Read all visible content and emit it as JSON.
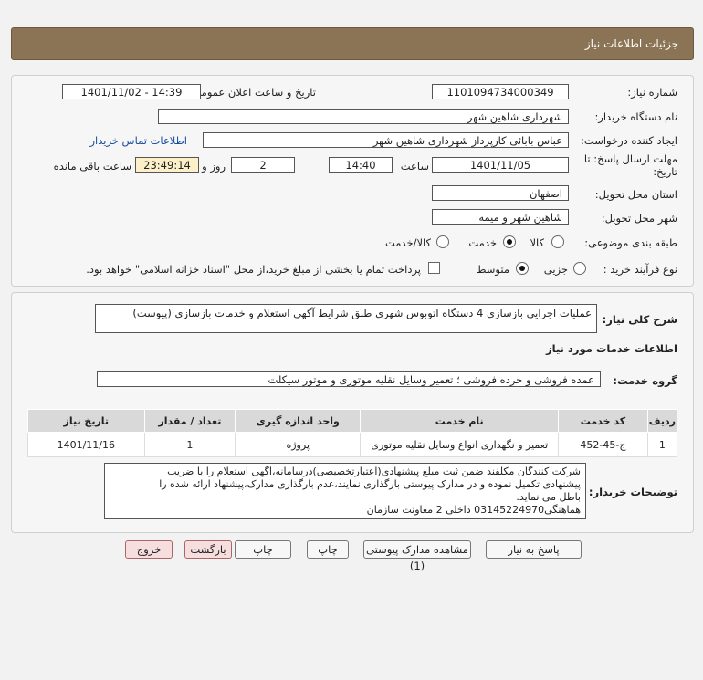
{
  "header": {
    "title": "جزئیات اطلاعات نیاز"
  },
  "form": {
    "need_number": {
      "label": "شماره نیاز:",
      "value": "1101094734000349"
    },
    "announce": {
      "label": "تاریخ و ساعت اعلان عمومی:",
      "value": "1401/11/02 - 14:39"
    },
    "buyer_org": {
      "label": "نام دستگاه خریدار:",
      "value": "شهرداری شاهین شهر"
    },
    "creator": {
      "label": "ایجاد کننده درخواست:",
      "value": "عباس بابائی کارپرداز شهرداری شاهین شهر",
      "contact_link": "اطلاعات تماس خریدار"
    },
    "deadline": {
      "label_line1": "مهلت ارسال پاسخ: تا",
      "label_line2": "تاریخ:",
      "date": "1401/11/05",
      "time_label": "ساعت",
      "time": "14:40",
      "days": "2",
      "days_label": "روز و",
      "remaining": "23:49:14",
      "remaining_label": "ساعت باقی مانده"
    },
    "province": {
      "label": "استان محل تحویل:",
      "value": "اصفهان"
    },
    "city": {
      "label": "شهر محل تحویل:",
      "value": "شاهین شهر و میمه"
    },
    "category": {
      "label": "طبقه بندی موضوعی:",
      "options": [
        "کالا",
        "خدمت",
        "کالا/خدمت"
      ],
      "selected": "خدمت"
    },
    "process": {
      "label": "نوع فرآیند خرید :",
      "options": [
        "جزیی",
        "متوسط"
      ],
      "selected": "متوسط",
      "checkbox_text": "پرداخت تمام یا بخشی از مبلغ خرید،از محل \"اسناد خزانه اسلامی\" خواهد بود."
    }
  },
  "summary": {
    "label": "شرح کلی نیاز:",
    "value": "عملیات اجرایی بازسازی 4 دستگاه اتوبوس شهری طبق شرایط آگهی استعلام و خدمات بازسازی (پیوست)"
  },
  "services": {
    "section_title": "اطلاعات خدمات مورد نیاز",
    "group_label": "گروه خدمت:",
    "group_value": "عمده فروشی و خرده فروشی ؛ تعمیر وسایل نقلیه موتوری و موتور سیکلت",
    "columns": [
      "ردیف",
      "کد خدمت",
      "نام خدمت",
      "واحد اندازه گیری",
      "تعداد / مقدار",
      "تاریخ نیاز"
    ],
    "rows": [
      [
        "1",
        "ج-45-452",
        "تعمیر و نگهداری انواع وسایل نقلیه موتوری",
        "پروژه",
        "1",
        "1401/11/16"
      ]
    ]
  },
  "buyer_notes": {
    "label": "توضیحات خریدار:",
    "lines": [
      "شرکت کنندگان مکلفند ضمن ثبت مبلغ پیشنهادی(اعتبارتخصیصی)درسامانه،آگهی استعلام را با ضریب",
      "پیشنهادی تکمیل نموده و در مدارک پیوستی بارگذاری نمایند،عدم بارگذاری مدارک،پیشنهاد ارائه شده را",
      "باطل می نماید.",
      "هماهنگی03145224970 داخلی 2 معاونت سازمان"
    ]
  },
  "buttons": {
    "reply": "پاسخ به نیاز",
    "view_docs": "مشاهده مدارک پیوستی (1)",
    "print": "چاپ",
    "back": "بازگشت",
    "exit": "خروج"
  },
  "colors": {
    "header": "#8a7455",
    "remaining_bg": "#fbf0c8",
    "link": "#1a4fa0",
    "pink_button": "#f7dede"
  }
}
